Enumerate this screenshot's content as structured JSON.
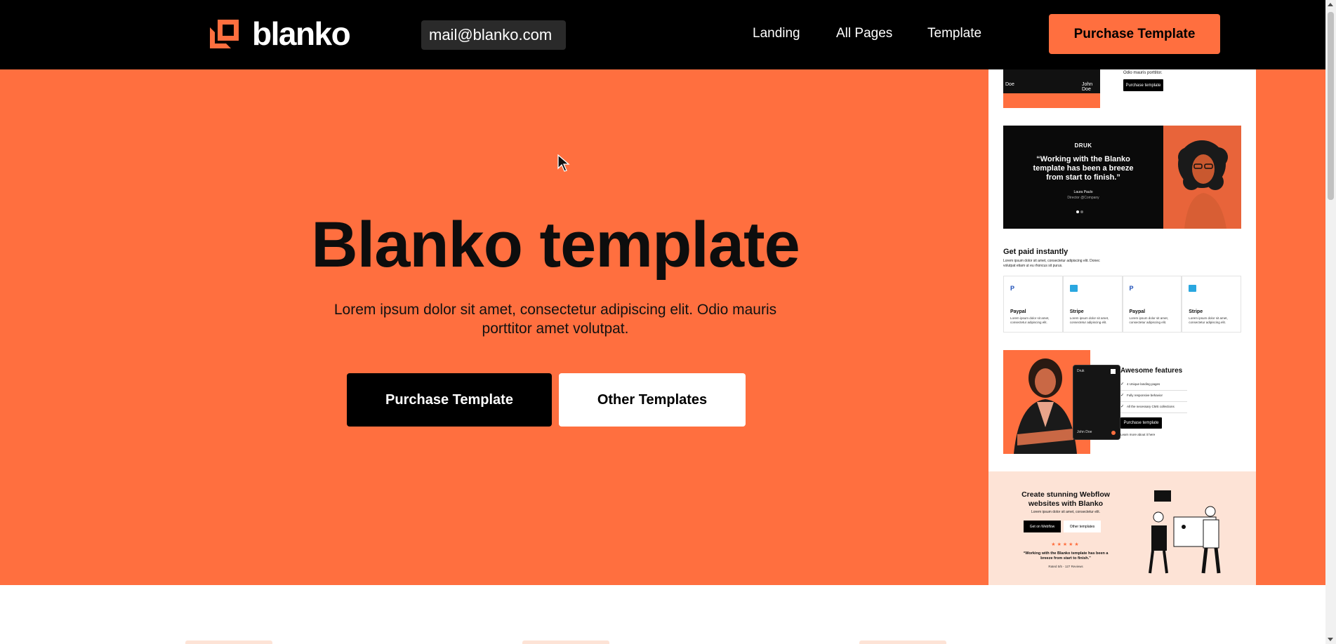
{
  "brand": {
    "name": "blanko"
  },
  "header": {
    "email": "mail@blanko.com",
    "nav": [
      {
        "label": "Landing"
      },
      {
        "label": "All Pages"
      },
      {
        "label": "Template"
      }
    ],
    "cta_label": "Purchase Template"
  },
  "hero": {
    "title": "Blanko template",
    "subtitle": "Lorem ipsum dolor sit amet, consectetur adipiscing elit. Odio mauris porttitor amet volutpat.",
    "primary_button": "Purchase Template",
    "secondary_button": "Other Templates"
  },
  "preview": {
    "top": {
      "names": [
        "Doe",
        "John Doe"
      ],
      "text": "Odio mauris porttitor.",
      "button": "Purchase template"
    },
    "testimonial": {
      "brand": "DRUK",
      "quote": "“Working with the Blanko template has been a breeze from start to finish.”",
      "person": "Laura Paulo",
      "role": "Director @Company"
    },
    "payments": {
      "title": "Get paid instantly",
      "text": "Lorem ipsum dolor sit amet, consectetur adipiscing elit. Donec volutpat etiam ut eu rhoncus sit purus.",
      "cards": [
        {
          "name": "Paypal",
          "desc": "Lorem ipsum dolor sit amet, consectetur adipiscing elit.",
          "icon": "paypal-icon",
          "color": "#1d4fb8"
        },
        {
          "name": "Stripe",
          "desc": "Lorem ipsum dolor sit amet, consectetur adipiscing elit.",
          "icon": "stripe-icon",
          "color": "#2aa7e0"
        },
        {
          "name": "Paypal",
          "desc": "Lorem ipsum dolor sit amet, consectetur adipiscing elit.",
          "icon": "paypal-icon",
          "color": "#1d4fb8"
        },
        {
          "name": "Stripe",
          "desc": "Lorem ipsum dolor sit amet, consectetur adipiscing elit.",
          "icon": "stripe-icon",
          "color": "#2aa7e0"
        }
      ]
    },
    "features": {
      "title": "Awesome features",
      "items": [
        "4 Unique landing pages",
        "Fully responsive behavior",
        "All the necessary CMS collections"
      ],
      "button": "Purchase template",
      "link": "Learn more about it here",
      "card_brand": "Druk",
      "card_holder": "John Doe"
    },
    "cta": {
      "title": "Create stunning Webflow websites with Blanko",
      "text": "Lorem ipsum dolor sit amet, consectetur elit.",
      "primary": "Get on Webflow",
      "secondary": "Other templates",
      "stars": "★★★★★",
      "quote": "“Working with the Blanko template has been a breeze from start to finish.”",
      "rating": "Rated 5/5 - 127 Reviews"
    }
  },
  "colors": {
    "accent": "#ff6f3f",
    "dark": "#000000",
    "light_accent": "#fde3d6"
  }
}
